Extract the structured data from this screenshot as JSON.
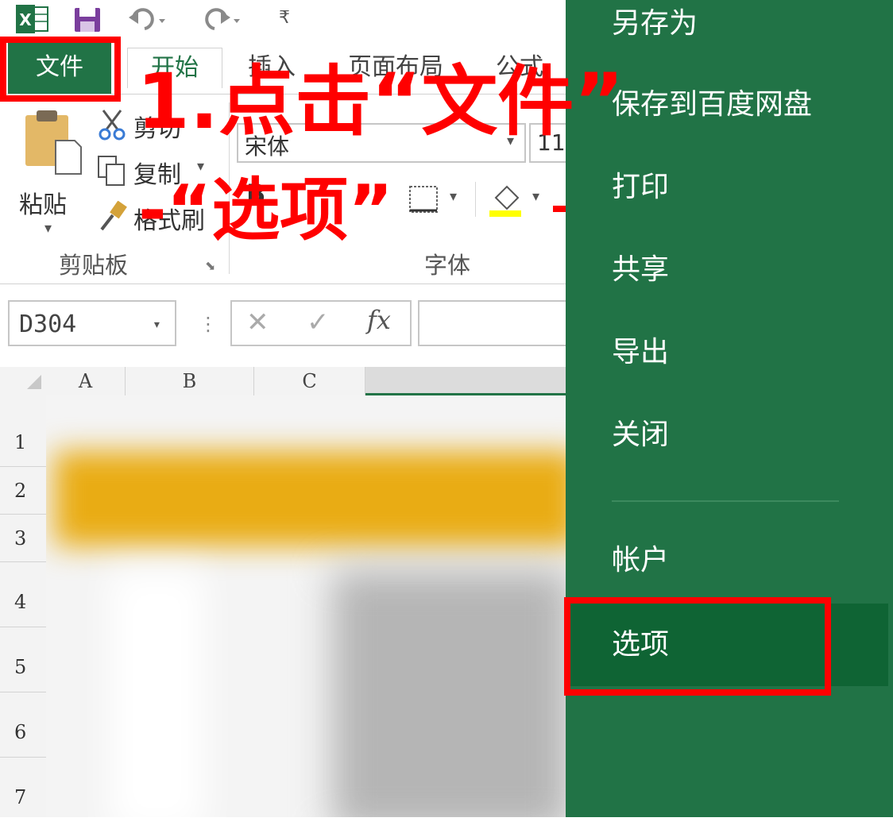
{
  "qat": {
    "app_icon": "excel-logo-icon",
    "save_icon": "save-icon",
    "undo_icon": "undo-icon",
    "redo_icon": "redo-icon",
    "customize_symbol": "₹"
  },
  "tabs": {
    "file": "文件",
    "home": "开始",
    "insert": "插入",
    "page_layout": "页面布局",
    "formulas": "公式"
  },
  "ribbon": {
    "clipboard": {
      "paste": "粘贴",
      "cut": "剪切",
      "copy": "复制",
      "format_painter": "格式刷",
      "group_label": "剪贴板"
    },
    "font": {
      "font_name": "宋体",
      "font_size": "11",
      "bold": "B",
      "group_label": "字体",
      "fill_color": "#ffff00",
      "font_color": "#ff0000"
    }
  },
  "formula_bar": {
    "name_box": "D304",
    "cancel_symbol": "✕",
    "enter_symbol": "✓",
    "fx_symbol": "fx",
    "value": ""
  },
  "grid": {
    "columns": [
      "A",
      "B",
      "C"
    ],
    "rows": [
      "1",
      "2",
      "3",
      "4",
      "5",
      "6",
      "7"
    ],
    "header_band_color": "#f0b400"
  },
  "backstage": {
    "items": [
      {
        "label": "另存为"
      },
      {
        "label": "保存到百度网盘"
      },
      {
        "label": "打印"
      },
      {
        "label": "共享"
      },
      {
        "label": "导出"
      },
      {
        "label": "关闭"
      },
      {
        "label": "帐户"
      },
      {
        "label": "选项"
      }
    ],
    "bg_color": "#217346",
    "active_color": "#0f6434"
  },
  "annotations": {
    "step_line1": "1.点击“文件”",
    "step_line2": "-“选项”",
    "color": "#ff0000"
  }
}
